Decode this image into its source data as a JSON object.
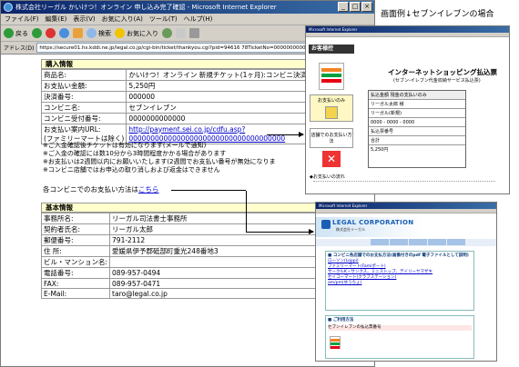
{
  "window": {
    "title": "株式会社リーガル かいけつ！オンライン 申し込み完了確認 - Microsoft Internet Explorer",
    "menu": [
      "ファイル(F)",
      "編集(E)",
      "表示(V)",
      "お気に入り(A)",
      "ツール(T)",
      "ヘルプ(H)"
    ],
    "toolbar": {
      "back": "戻る",
      "search": "検索",
      "favorites": "お気に入り"
    },
    "address_label": "アドレス(D)",
    "address": "https://secure01.hs.kddi.ne.jp/legal.co.jp/cgi-bin/ticket/thankyou.cgi?pid=94616 78TicketNo=00000000000000000000000"
  },
  "purchase": {
    "heading": "購入情報",
    "rows": [
      {
        "label": "商品名:",
        "value": "かいけつ！オンライン 新規チケット(1ヶ月):コンビニ決済"
      },
      {
        "label": "お支払い金額:",
        "value": "5,250円"
      },
      {
        "label": "決済番号:",
        "value": "000000"
      },
      {
        "label": "コンビニ名:",
        "value": "セブンイレブン"
      },
      {
        "label": "コンビニ受付番号:",
        "value": "0000000000000"
      }
    ],
    "guide_label": "お支払い案内URL:",
    "guide_label2": "(ファミリーマートは除く)",
    "guide_url": "http://payment.sei.co.jp/cdfu.asp?",
    "guide_url2": "000000000000000000000000000000000000"
  },
  "notes": [
    "※ご入金確認後チケットは有効になります(メールで通知)",
    "※ご入金の確認には数10分から3時間程度かかる場合があります",
    "※お支払いは2週間以内にお願いいたします(2週間でお支払い番号が無効になりま",
    "※コンビニ店舗ではお申込の取り消しおよび返金はできません"
  ],
  "convenience_line": {
    "prefix": "各コンビニでのお支払い方法は",
    "link": "こちら"
  },
  "basic": {
    "heading": "基本情報",
    "rows": [
      {
        "label": "事務所名:",
        "value": "リーガル司法書士事務所"
      },
      {
        "label": "契約者氏名:",
        "value": "リーガル太郎"
      },
      {
        "label": "郵便番号:",
        "value": "791-2112"
      },
      {
        "label": "住 所:",
        "value": "愛媛県伊予郡砥部町重光248番地3"
      },
      {
        "label": "ビル・マンション名:",
        "value": ""
      },
      {
        "label": "電話番号:",
        "value": "089-957-0494"
      },
      {
        "label": "FAX:",
        "value": "089-957-0471"
      },
      {
        "label": "E-Mail:",
        "value": "taro@legal.co.jp"
      }
    ]
  },
  "side": {
    "caption": "画面例↓セブンイレブンの場合",
    "seven": {
      "window_title": "Microsoft Internet Explorer",
      "head": "お客様控",
      "title": "インターネットショッピング払込票",
      "subtitle": "(セブン-イレブン代金収納サービス払込票)",
      "pay_only": "お支払いのみ",
      "shop_note": "店舗でのお支払い方法",
      "slip_rows": [
        "払込金額 現金の支払いのみ",
        "リーガル太郎 様",
        "リーガル(新規)",
        "0000 - 0000 - 0000",
        "払込票番号",
        "合計",
        "5,250円"
      ],
      "flow": "◆お支払いの流れ"
    },
    "legal": {
      "window_title": "Microsoft Internet Explorer",
      "brand": "LEGAL CORPORATION",
      "brand_sub": "株式会社リーガル",
      "box1_title": "■ コンビニ各店舗でのお支払方法(画像付きのpdf 電子ファイルとして説明)",
      "box1_items": [
        "ローソン(Loppi)",
        "ファミリーマート(Famiポート)",
        "サークルK・サンクス、ミニストップ、デイリーヤマザキ",
        "セイコーマート(クラブステーション)",
        "am/pm(ゆうちょ)"
      ],
      "box2_title": "■ ご利用方法",
      "box2_text": "セブンイレブンの払込票番号"
    }
  }
}
